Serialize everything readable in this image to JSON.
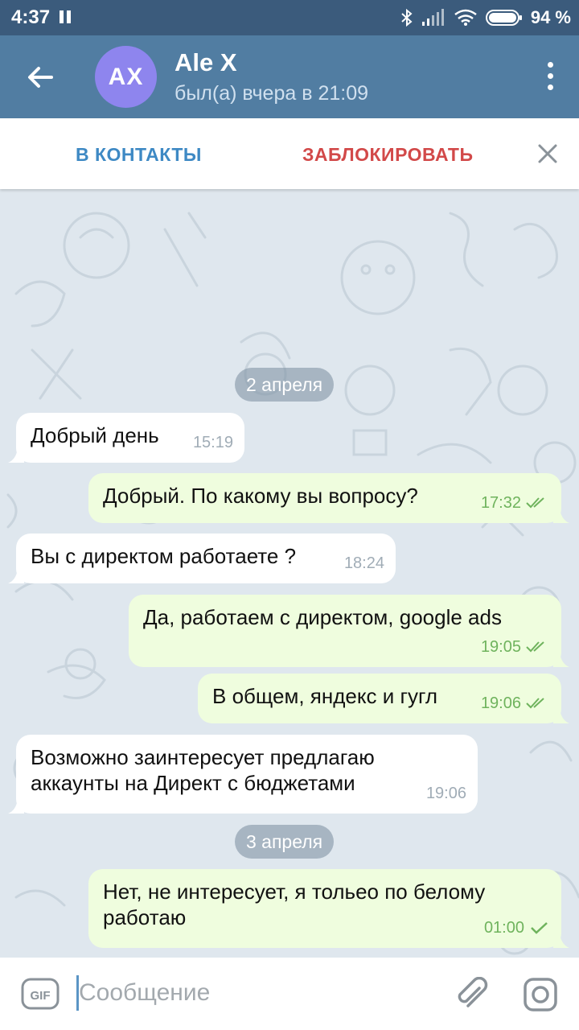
{
  "status_bar": {
    "time": "4:37",
    "battery": "94 %"
  },
  "chat": {
    "avatar_initials": "AX",
    "name": "Ale X",
    "last_seen": "был(а) вчера в 21:09"
  },
  "action_bar": {
    "add_contact": "В КОНТАКТЫ",
    "block": "ЗАБЛОКИРОВАТЬ"
  },
  "dates": [
    "2 апреля",
    "3 апреля"
  ],
  "messages": [
    {
      "dir": "in",
      "text": "Добрый день",
      "time": "15:19"
    },
    {
      "dir": "out",
      "text": "Добрый. По какому вы вопросу?",
      "time": "17:32",
      "status": "read"
    },
    {
      "dir": "in",
      "text": "Вы с директом работаете ?",
      "time": "18:24"
    },
    {
      "dir": "out",
      "text": "Да, работаем с директом, google ads",
      "time": "19:05",
      "status": "read"
    },
    {
      "dir": "out",
      "text": "В общем, яндекс и гугл",
      "time": "19:06",
      "status": "read"
    },
    {
      "dir": "in",
      "text": "Возможно заинтересует предлагаю аккаунты на Директ с бюджетами",
      "time": "19:06"
    },
    {
      "dir": "out",
      "text": "Нет,  не интересует,  я тольео по белому работаю",
      "time": "01:00",
      "status": "sent"
    }
  ],
  "composer": {
    "gif_label": "GIF",
    "placeholder": "Сообщение"
  },
  "icons": [
    "pause-icon",
    "bluetooth-icon",
    "signal-icon",
    "wifi-icon",
    "battery-icon",
    "back-arrow-icon",
    "more-vert-icon",
    "close-icon",
    "double-check-icon",
    "check-icon",
    "gif-icon",
    "paperclip-icon",
    "camera-icon"
  ],
  "colors": {
    "header": "#517da2",
    "status_bar": "#3b5b7c",
    "avatar": "#8e85ee",
    "add_contact": "#3e89c4",
    "block": "#d24949",
    "out_bubble": "#effdde",
    "chat_bg": "#dfe7ee",
    "read_check": "#6fb35d"
  }
}
